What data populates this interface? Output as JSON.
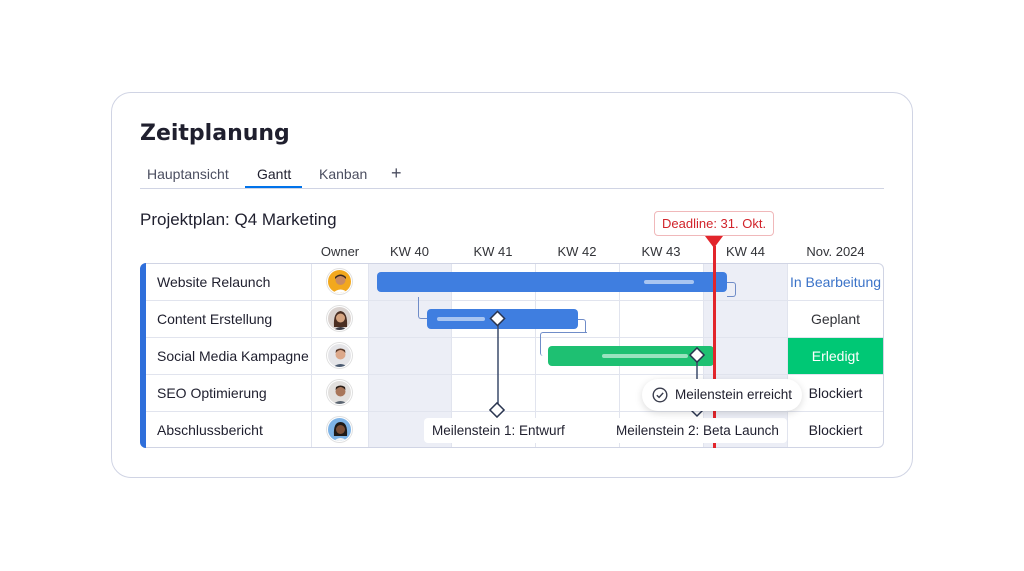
{
  "title": "Zeitplanung",
  "tabs": [
    {
      "label": "Hauptansicht"
    },
    {
      "label": "Gantt"
    },
    {
      "label": "Kanban"
    }
  ],
  "tab_add": "+",
  "subtitle": "Projektplan: Q4 Marketing",
  "columns": {
    "owner": "Owner",
    "weeks": [
      "KW 40",
      "KW 41",
      "KW 42",
      "KW 43",
      "KW 44"
    ],
    "month": "Nov. 2024"
  },
  "tasks": [
    {
      "name": "Website Relaunch",
      "status": "In Bearbeitung"
    },
    {
      "name": "Content Erstellung",
      "status": "Geplant"
    },
    {
      "name": "Social Media Kampagne",
      "status": "Erledigt"
    },
    {
      "name": "SEO Optimierung",
      "status": "Blockiert"
    },
    {
      "name": "Abschlussbericht",
      "status": "Blockiert"
    }
  ],
  "deadline_label": "Deadline: 31. Okt.",
  "milestones": [
    {
      "label": "Meilenstein 1: Entwurf"
    },
    {
      "label": "Meilenstein 2: Beta Launch"
    }
  ],
  "toast": "Meilenstein erreicht",
  "colors": {
    "accent": "#0073ea",
    "bar_blue": "#3f7ee0",
    "bar_green": "#1ec072",
    "status_done": "#00c875",
    "status_progress_text": "#3b73c8",
    "deadline": "#e2252b"
  },
  "icons": {
    "tab_add": "plus-icon",
    "toast": "check-circle-icon",
    "milestone": "diamond-icon",
    "deadline": "triangle-marker-icon"
  }
}
